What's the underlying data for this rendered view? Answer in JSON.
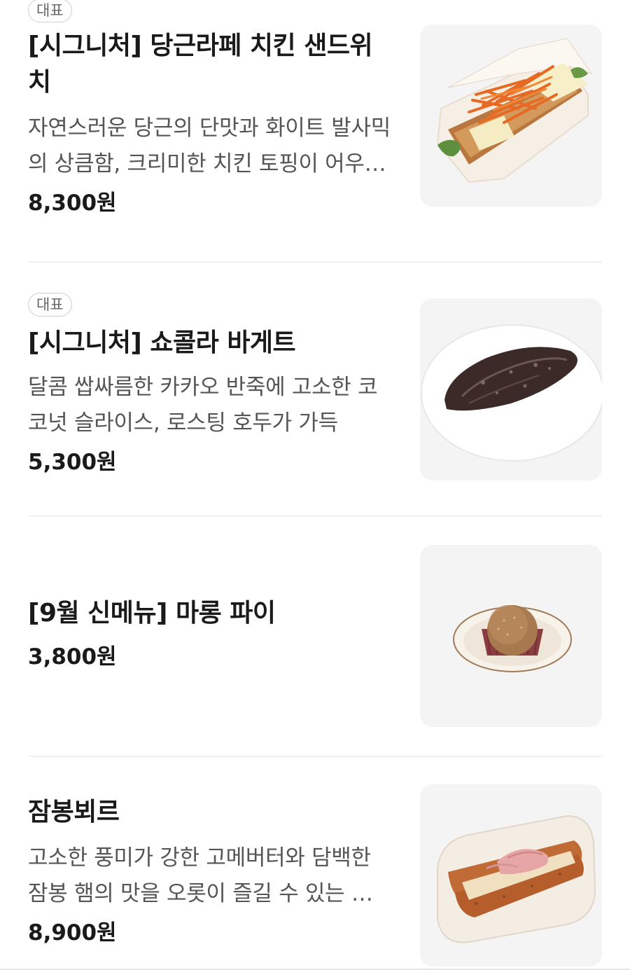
{
  "menu": {
    "items": [
      {
        "badge": "대표",
        "title_line1": "[시그니처] 당근라페 치킨 샌드위",
        "title_line2": "치",
        "description": "자연스러운 당근의 단맛과 화이트 발사믹의 상큼함, 크리미한 치킨 토핑이 어우러진 샌드위치",
        "price": "8,300원",
        "image_icon": "carrot-chicken-sandwich"
      },
      {
        "badge": "대표",
        "title": "[시그니처] 쇼콜라 바게트",
        "description": "달콤 쌉싸름한 카카오 반죽에 고소한 코코넛 슬라이스, 로스팅 호두가 가득",
        "price": "5,300원",
        "image_icon": "chocolate-baguette"
      },
      {
        "title": "[9월 신메뉴] 마롱 파이",
        "price": "3,800원",
        "image_icon": "marron-pie"
      },
      {
        "title": "잠봉뵈르",
        "description": "고소한 풍미가 강한 고메버터와 담백한 잠봉 햄의 맛을 오롯이 즐길 수 있는 샌드위치",
        "price": "8,900원",
        "image_icon": "jambon-beurre-sandwich"
      }
    ]
  }
}
